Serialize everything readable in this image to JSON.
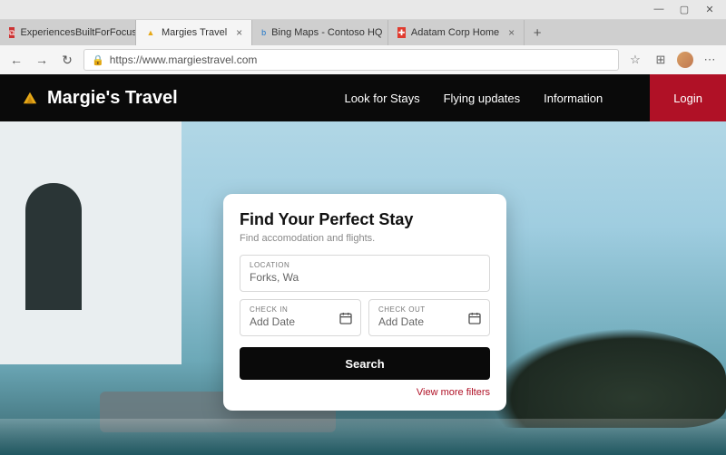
{
  "window": {
    "minimize": "—",
    "maximize": "▢",
    "close": "✕"
  },
  "tabs": [
    {
      "label": "ExperiencesBuiltForFocus.pdf",
      "active": false,
      "favicon_color": "#c33"
    },
    {
      "label": "Margies Travel",
      "active": true,
      "favicon_color": "#e6a817"
    },
    {
      "label": "Bing Maps - Contoso HQ",
      "active": false,
      "favicon_color": "#1a73c9"
    },
    {
      "label": "Adatam Corp Home",
      "active": false,
      "favicon_color": "#e03b2f"
    }
  ],
  "url": "https://www.margiestravel.com",
  "brand": {
    "name": "Margie's Travel"
  },
  "nav": {
    "links": [
      "Look for Stays",
      "Flying updates",
      "Information"
    ],
    "login": "Login"
  },
  "search": {
    "title": "Find Your Perfect Stay",
    "subtitle": "Find accomodation and flights.",
    "location_label": "LOCATION",
    "location_value": "Forks, Wa",
    "checkin_label": "CHECK IN",
    "checkin_value": "Add Date",
    "checkout_label": "CHECK OUT",
    "checkout_value": "Add Date",
    "button": "Search",
    "more": "View more filters"
  }
}
